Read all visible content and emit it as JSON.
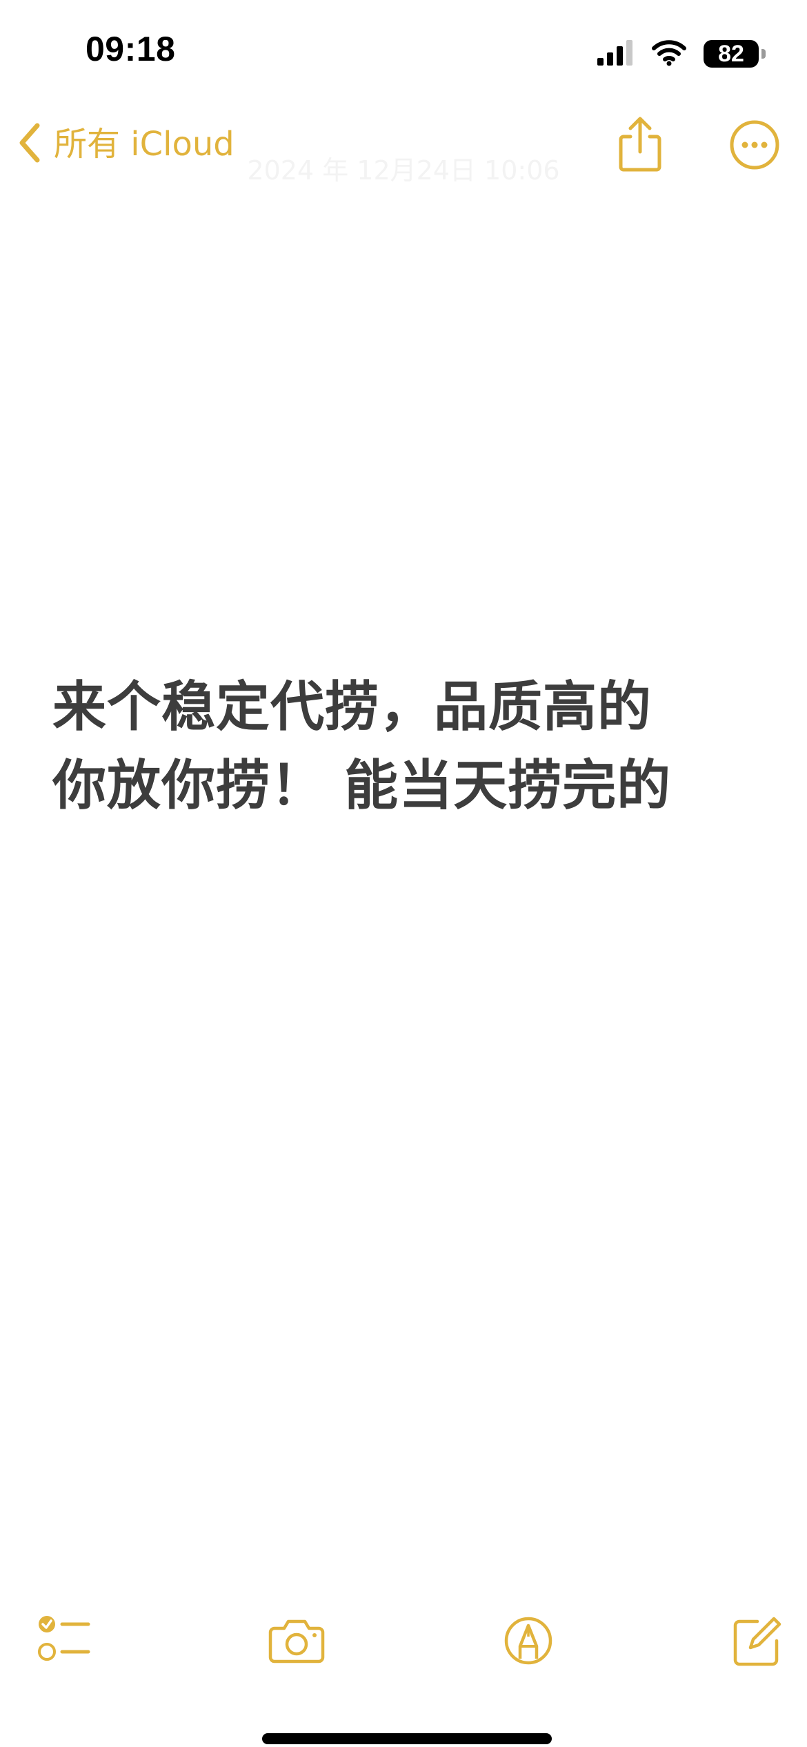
{
  "status_bar": {
    "time": "09:18",
    "battery": "82",
    "icons": [
      "signal-icon",
      "wifi-icon",
      "battery-icon"
    ]
  },
  "nav": {
    "back_label": "所有 iCloud",
    "icons": [
      "chevron-left-icon",
      "share-icon",
      "more-icon"
    ]
  },
  "note": {
    "date": "2024 年 12月24日 10:06",
    "lines": [
      "来个稳定代捞，品质高的",
      "你放你捞！ 能当天捞完的"
    ]
  },
  "toolbar": {
    "icons": [
      "checklist-icon",
      "camera-icon",
      "markup-icon",
      "compose-icon"
    ]
  },
  "colors": {
    "accent": "#E1B33C",
    "note_text": "#3d3d3d",
    "background": "#ffffff"
  }
}
